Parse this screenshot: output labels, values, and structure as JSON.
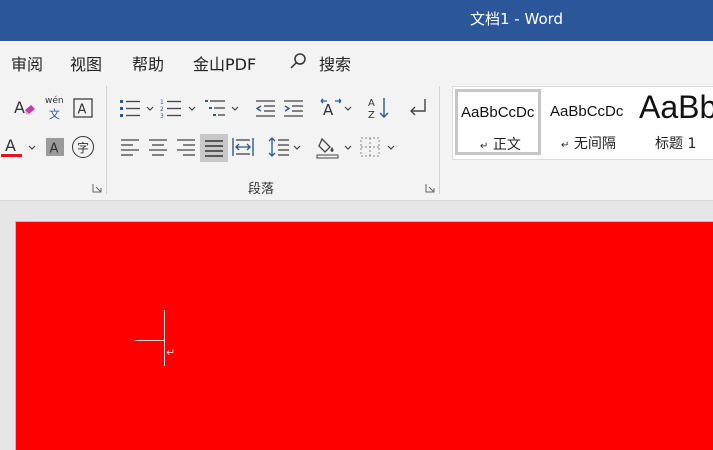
{
  "window": {
    "title": "文档1  -  Word"
  },
  "menu": {
    "review": "审阅",
    "view": "视图",
    "help": "帮助",
    "wps_pdf": "金山PDF",
    "search": "搜索"
  },
  "ribbon": {
    "paragraph_group_label": "段落",
    "font_buttons": {
      "phonetic_text": "wén",
      "phonetic_char": "文",
      "enclosed_char": "字"
    },
    "accent_color": "#2b579a",
    "font_color": "#e81123"
  },
  "styles": [
    {
      "sample": "AaBbCcDc",
      "name": "正文",
      "mark": "↵"
    },
    {
      "sample": "AaBbCcDc",
      "name": "无间隔",
      "mark": "↵"
    },
    {
      "sample": "AaBb",
      "name": "标题 1",
      "mark": ""
    }
  ],
  "document": {
    "page_color": "#ff0000",
    "paragraph_mark": "↵"
  }
}
